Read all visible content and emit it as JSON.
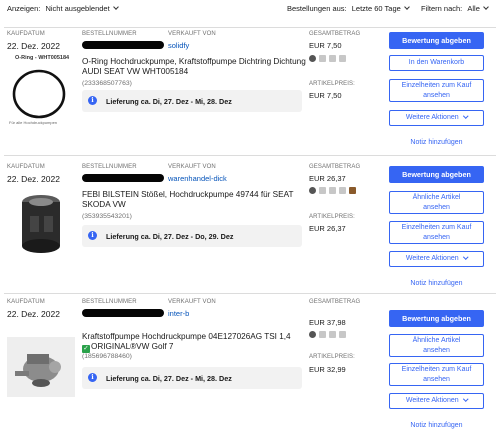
{
  "toolbar": {
    "show_label": "Anzeigen:",
    "show_value": "Nicht ausgeblendet",
    "orders_from_label": "Bestellungen aus:",
    "orders_from_value": "Letzte 60 Tage",
    "filter_label": "Filtern nach:",
    "filter_value": "Alle"
  },
  "labels": {
    "order_date": "KAUFDATUM",
    "order_number": "BESTELLNUMMER",
    "sold_by": "VERKAUFT VON",
    "total": "GESAMTBETRAG",
    "item_price": "ARTIKELPREIS:"
  },
  "actions": {
    "rate": "Bewertung abgeben",
    "add_to_cart": "In den Warenkorb",
    "purchase_details_line1": "Einzelheiten zum Kauf",
    "purchase_details_line2": "ansehen",
    "similar_line1": "Ähnliche Artikel",
    "similar_line2": "ansehen",
    "more_actions": "Weitere Aktionen",
    "add_note": "Notiz hinzufügen"
  },
  "orders": [
    {
      "date": "22. Dez. 2022",
      "seller": "solidfy",
      "title": "O-Ring Hochdruckpumpe, Kraftstoffpumpe Dichtring Dichtung AUDI SEAT VW WHT005184",
      "item_number": "(233368507763)",
      "delivery": "Lieferung ca. Di, 27. Dez - Mi, 28. Dez",
      "total": "EUR 7,50",
      "item_price": "EUR 7,50",
      "thumb_top_label": "O-Ring - WHT005184",
      "thumb_bottom_label": "Für alle Hochdruckpumpen"
    },
    {
      "date": "22. Dez. 2022",
      "seller": "warenhandel-dick",
      "title": "FEBI BILSTEIN Stößel, Hochdruckpumpe 49744 für SEAT SKODA VW",
      "item_number": "(353935543201)",
      "delivery": "Lieferung ca. Di, 27. Dez - Do, 29. Dez",
      "total": "EUR 26,37",
      "item_price": "EUR 26,37"
    },
    {
      "date": "22. Dez. 2022",
      "seller": "inter-b",
      "title_line1": "Kraftstoffpumpe Hochdruckpumpe 04E127026AG TSI 1,4",
      "title_line2": "ORIGINAL®VW Golf 7",
      "item_number": "(185696788460)",
      "delivery": "Lieferung ca. Di, 27. Dez - Mi, 28. Dez",
      "total": "EUR 37,98",
      "item_price": "EUR 32,99"
    }
  ]
}
